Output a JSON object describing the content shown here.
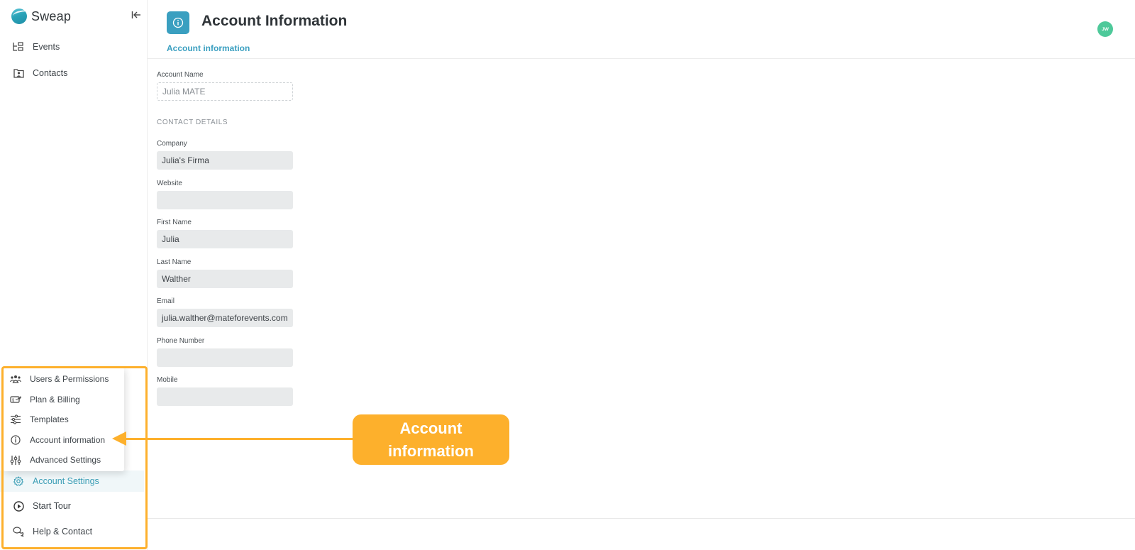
{
  "app": {
    "brand_name": "Sweap",
    "collapse_icon": "collapse-left-icon"
  },
  "sidebar": {
    "items": [
      {
        "label": "Events",
        "icon": "events-icon"
      },
      {
        "label": "Contacts",
        "icon": "contacts-icon"
      }
    ],
    "bottom_items": [
      {
        "label": "Account Settings",
        "icon": "gear-icon",
        "active": true
      },
      {
        "label": "Start Tour",
        "icon": "play-circle-icon"
      },
      {
        "label": "Help & Contact",
        "icon": "chat-icon"
      }
    ],
    "account_menu": [
      {
        "label": "Users & Permissions",
        "icon": "users-icon"
      },
      {
        "label": "Plan & Billing",
        "icon": "billing-icon"
      },
      {
        "label": "Templates",
        "icon": "sliders-icon"
      },
      {
        "label": "Account information",
        "icon": "info-icon"
      },
      {
        "label": "Advanced Settings",
        "icon": "advanced-settings-icon"
      }
    ]
  },
  "header": {
    "title": "Account Information",
    "active_tab": "Account information",
    "avatar_initials": "JW",
    "accent_color": "#3a9fc0",
    "avatar_color": "#4ec99a"
  },
  "form": {
    "account_name": {
      "label": "Account Name",
      "value": "Julia MATE"
    },
    "section_title": "CONTACT DETAILS",
    "fields": [
      {
        "label": "Company",
        "value": "Julia's Firma"
      },
      {
        "label": "Website",
        "value": ""
      },
      {
        "label": "First Name",
        "value": "Julia"
      },
      {
        "label": "Last Name",
        "value": "Walther"
      },
      {
        "label": "Email",
        "value": "julia.walther@mateforevents.com"
      },
      {
        "label": "Phone Number",
        "value": ""
      },
      {
        "label": "Mobile",
        "value": ""
      }
    ]
  },
  "annotation": {
    "callout_text": "Account information",
    "color": "#fdb02c"
  }
}
